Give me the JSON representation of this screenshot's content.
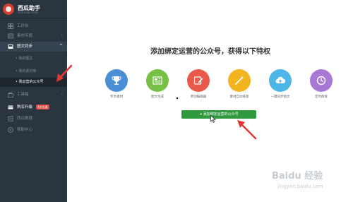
{
  "brand": {
    "name": "西瓜助手",
    "url": "XIGUAA.COM"
  },
  "sidebar": {
    "items": [
      {
        "label": "工作台",
        "icon": "dashboard-icon"
      },
      {
        "label": "素材专题",
        "icon": "material-icon",
        "chevron": "›"
      },
      {
        "label": "图文同步",
        "icon": "sync-icon",
        "chevron": "^"
      },
      {
        "label": "工具箱",
        "icon": "toolbox-icon",
        "chevron": "›"
      },
      {
        "label": "购买升级",
        "icon": "upgrade-icon",
        "badge": "4折优惠"
      },
      {
        "label": "西瓜数据",
        "icon": "data-icon"
      },
      {
        "label": "帮助中心",
        "icon": "help-icon"
      }
    ],
    "sub_items": [
      {
        "label": "• 我的图文"
      },
      {
        "label": "• 我的素材库"
      },
      {
        "label": "• 我运营的公众号"
      }
    ]
  },
  "main": {
    "title": "添加绑定运营的公众号，获得以下特权",
    "features": [
      {
        "label": "专享素材",
        "icon": "trophy-icon",
        "color": "#4a8fd6"
      },
      {
        "label": "图文生成",
        "icon": "newspaper-icon",
        "color": "#76c043"
      },
      {
        "label": "原创编辑器",
        "icon": "edit-icon",
        "color": "#e95a4a"
      },
      {
        "label": "素材自动排版",
        "icon": "magic-wand-icon",
        "color": "#f3b51f"
      },
      {
        "label": "一键同步图文",
        "icon": "cloud-upload-icon",
        "color": "#4cb6e6"
      },
      {
        "label": "定时群发",
        "icon": "clock-icon",
        "color": "#a878d6"
      }
    ],
    "add_button": {
      "plus": "+",
      "label": "添加绑定运营的公众号"
    }
  },
  "watermark": {
    "main": "Baidu 经验",
    "sub": "jingyan.baidu.com"
  },
  "colors": {
    "sidebar_bg": "#2b3540",
    "accent_green": "#2e9a3d",
    "annotation_red": "#e53935"
  }
}
